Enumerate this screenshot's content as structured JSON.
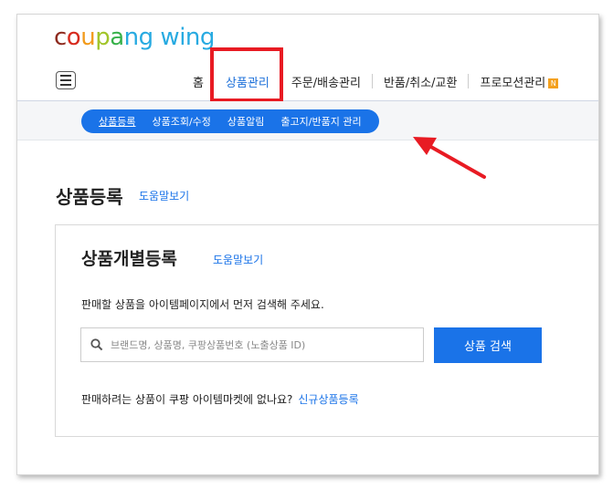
{
  "logo": {
    "letters": [
      {
        "ch": "c",
        "color": "#8e2b1f"
      },
      {
        "ch": "o",
        "color": "#d72b1f"
      },
      {
        "ch": "u",
        "color": "#f29b1c"
      },
      {
        "ch": "p",
        "color": "#a2c52a"
      },
      {
        "ch": "a",
        "color": "#37b14a"
      },
      {
        "ch": "n",
        "color": "#27aae1"
      },
      {
        "ch": "g",
        "color": "#27aae1"
      },
      {
        "ch": " ",
        "color": "#ffffff"
      },
      {
        "ch": "w",
        "color": "#27aae1"
      },
      {
        "ch": "i",
        "color": "#27aae1"
      },
      {
        "ch": "n",
        "color": "#27aae1"
      },
      {
        "ch": "g",
        "color": "#27aae1"
      }
    ]
  },
  "nav": {
    "menu_icon": "hamburger-icon",
    "items": [
      "홈",
      "상품관리",
      "주문/배송관리",
      "반품/취소/교환",
      "프로모션관리"
    ],
    "active_index": 1,
    "new_badge": "N"
  },
  "subnav": {
    "items": [
      "상품등록",
      "상품조회/수정",
      "상품알림",
      "출고지/반품지 관리"
    ],
    "current_index": 0
  },
  "page": {
    "title": "상품등록",
    "help": "도움말보기"
  },
  "card": {
    "title": "상품개별등록",
    "help": "도움말보기",
    "description": "판매할 상품을 아이템페이지에서 먼저 검색해 주세요.",
    "search_placeholder": "브랜드명, 상품명, 쿠팡상품번호 (노출상품 ID)",
    "search_icon": "search-icon",
    "search_button": "상품 검색",
    "question": "판매하려는 상품이 쿠팡 아이템마켓에 없나요?",
    "new_product_link": "신규상품등록"
  },
  "colors": {
    "accent": "#1a73e8",
    "highlight": "#e81b23"
  }
}
